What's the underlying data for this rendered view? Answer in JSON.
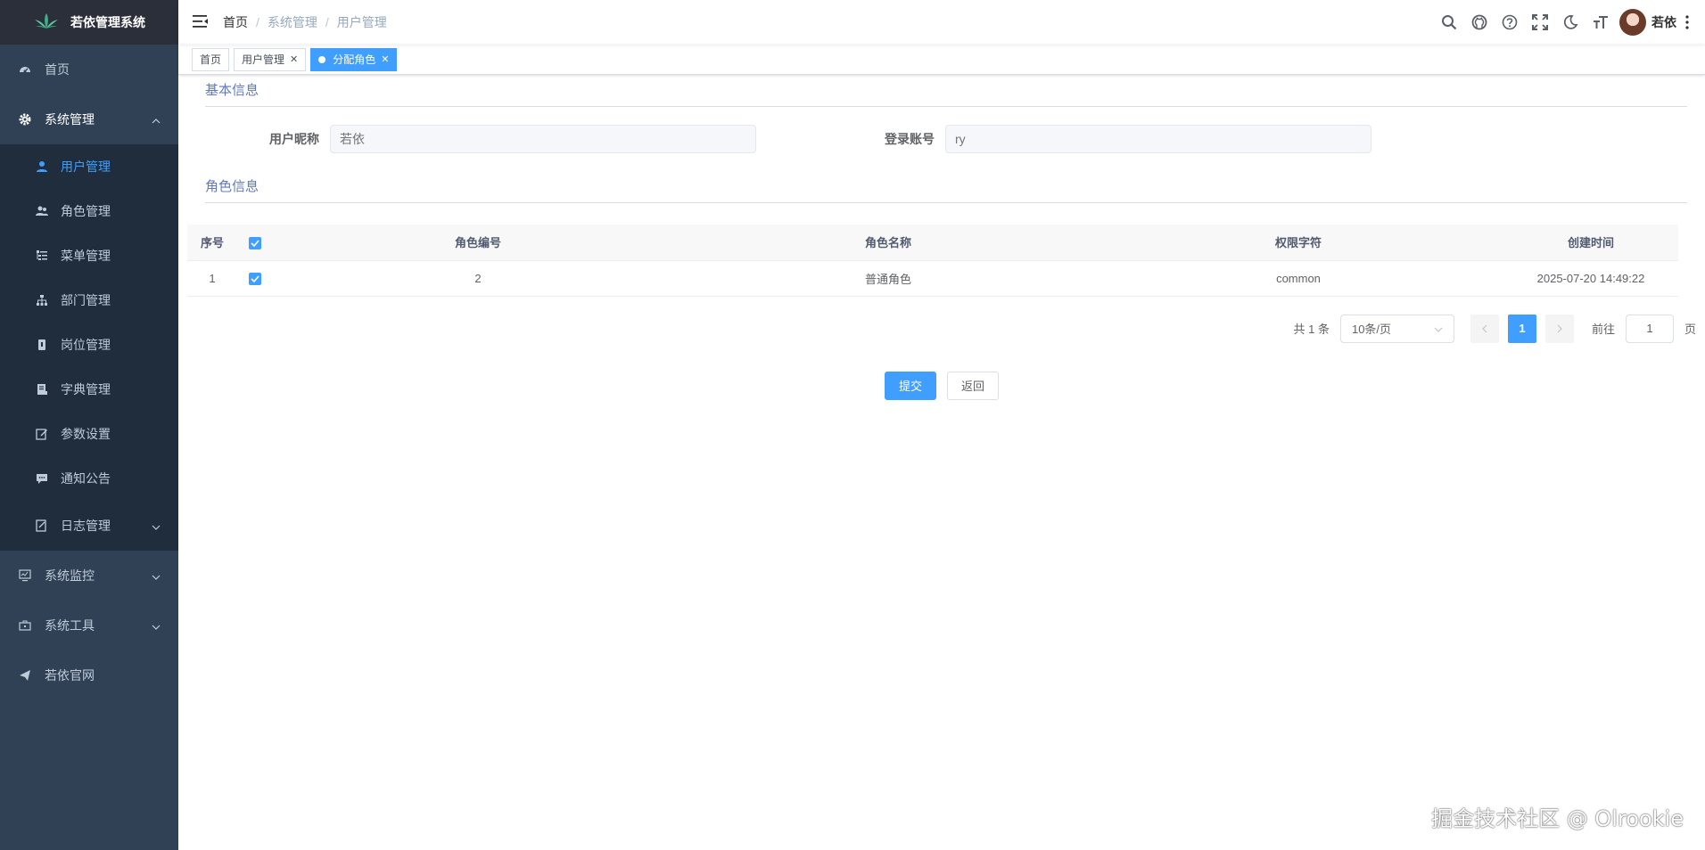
{
  "app": {
    "title": "若依管理系统"
  },
  "sidebar": {
    "items": [
      {
        "label": "首页",
        "icon": "dashboard-icon"
      },
      {
        "label": "系统管理",
        "icon": "gear-icon",
        "expanded": true,
        "children": [
          {
            "label": "用户管理",
            "icon": "user-icon",
            "active": true
          },
          {
            "label": "角色管理",
            "icon": "peoples-icon"
          },
          {
            "label": "菜单管理",
            "icon": "tree-table-icon"
          },
          {
            "label": "部门管理",
            "icon": "tree-icon"
          },
          {
            "label": "岗位管理",
            "icon": "post-icon"
          },
          {
            "label": "字典管理",
            "icon": "dict-icon"
          },
          {
            "label": "参数设置",
            "icon": "edit-icon"
          },
          {
            "label": "通知公告",
            "icon": "message-icon"
          },
          {
            "label": "日志管理",
            "icon": "log-icon"
          }
        ]
      },
      {
        "label": "系统监控",
        "icon": "monitor-icon"
      },
      {
        "label": "系统工具",
        "icon": "tool-icon"
      },
      {
        "label": "若依官网",
        "icon": "guide-icon"
      }
    ]
  },
  "breadcrumb": [
    "首页",
    "系统管理",
    "用户管理"
  ],
  "header": {
    "username": "若依"
  },
  "tags": [
    {
      "label": "首页"
    },
    {
      "label": "用户管理"
    },
    {
      "label": "分配角色",
      "active": true
    }
  ],
  "basic_info": {
    "title": "基本信息",
    "nickname_label": "用户昵称",
    "nickname_value": "若依",
    "account_label": "登录账号",
    "account_value": "ry"
  },
  "role_info": {
    "title": "角色信息",
    "columns": [
      "序号",
      "角色编号",
      "角色名称",
      "权限字符",
      "创建时间"
    ],
    "rows": [
      {
        "index": "1",
        "role_id": "2",
        "role_name": "普通角色",
        "role_key": "common",
        "create_time": "2025-07-20 14:49:22",
        "checked": true
      }
    ]
  },
  "pagination": {
    "total_text": "共 1 条",
    "page_size": "10条/页",
    "current_page": "1",
    "goto_label": "前往",
    "goto_value": "1",
    "page_unit": "页"
  },
  "actions": {
    "submit": "提交",
    "back": "返回"
  },
  "watermark": "掘金技术社区 @ Olrookie",
  "colors": {
    "sidebar_bg": "#304156",
    "submenu_bg": "#1f2d3d",
    "accent": "#409eff",
    "section_title": "#6379bb"
  }
}
